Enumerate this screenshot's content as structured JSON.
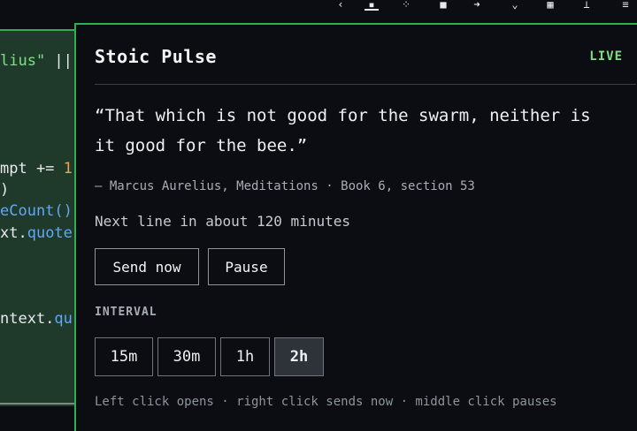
{
  "editor": {
    "lines": [
      {
        "pre": "",
        "str": "lius\"",
        "post": " ||"
      },
      {
        "pre": "mpt += ",
        "num": "1"
      },
      {
        "pre": ")"
      },
      {
        "prop": "eCount()"
      },
      {
        "pre": "xt.",
        "prop": "quote"
      },
      {
        "pre": "ntext.",
        "prop": "qu"
      }
    ]
  },
  "panel": {
    "title": "Stoic Pulse",
    "status": "LIVE",
    "quote": "“That which is not good for the swarm, neither is it good for the bee.”",
    "attribution": "— Marcus Aurelius, Meditations · Book 6, section 53",
    "next_line": "Next line in about 120 minutes",
    "buttons": {
      "send_now": "Send now",
      "pause": "Pause"
    },
    "interval_label": "INTERVAL",
    "intervals": [
      "15m",
      "30m",
      "1h",
      "2h"
    ],
    "selected_interval": "2h",
    "footer": "Left click opens · right click sends now · middle click pauses"
  },
  "colors": {
    "accent": "#2fae54",
    "live": "#7ee084",
    "background": "#0b0d12"
  }
}
